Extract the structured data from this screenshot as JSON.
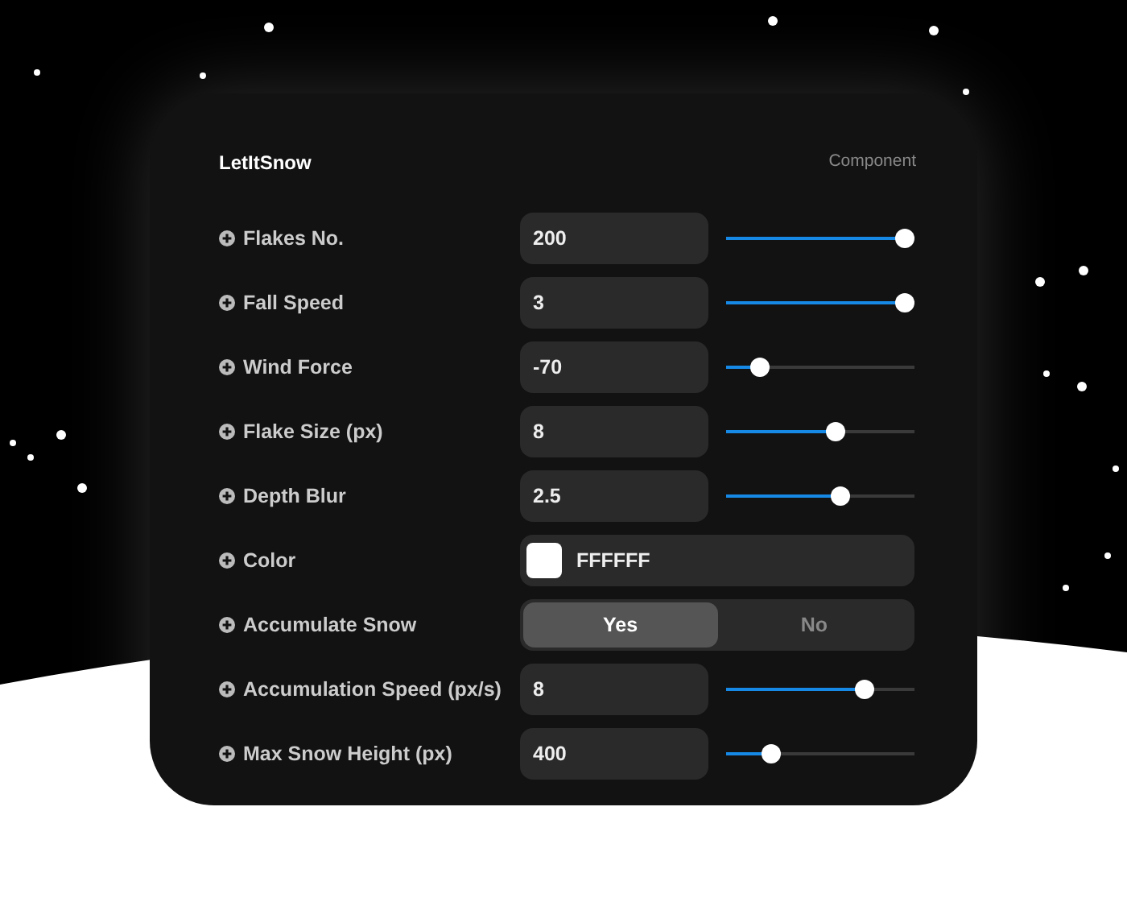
{
  "panel": {
    "title": "LetItSnow",
    "subtitle": "Component"
  },
  "properties": [
    {
      "kind": "slider",
      "label": "Flakes No.",
      "value": "200",
      "level": 1
    },
    {
      "kind": "slider",
      "label": "Fall Speed",
      "value": "3",
      "level": 1
    },
    {
      "kind": "slider",
      "label": "Wind Force",
      "value": "-70",
      "level": 0.14
    },
    {
      "kind": "slider",
      "label": "Flake Size (px)",
      "value": "8",
      "level": 0.59
    },
    {
      "kind": "slider",
      "label": "Depth Blur",
      "value": "2.5",
      "level": 0.62
    },
    {
      "kind": "color",
      "label": "Color",
      "value": "FFFFFF",
      "color": "#ffffff"
    },
    {
      "kind": "toggle",
      "label": "Accumulate Snow",
      "options": [
        {
          "label": "Yes",
          "selected": true
        },
        {
          "label": "No",
          "selected": false
        }
      ]
    },
    {
      "kind": "slider",
      "label": "Accumulation Speed (px/s)",
      "value": "8",
      "level": 0.76
    },
    {
      "kind": "slider",
      "label": "Max Snow Height (px)",
      "value": "400",
      "level": 0.21
    }
  ]
}
